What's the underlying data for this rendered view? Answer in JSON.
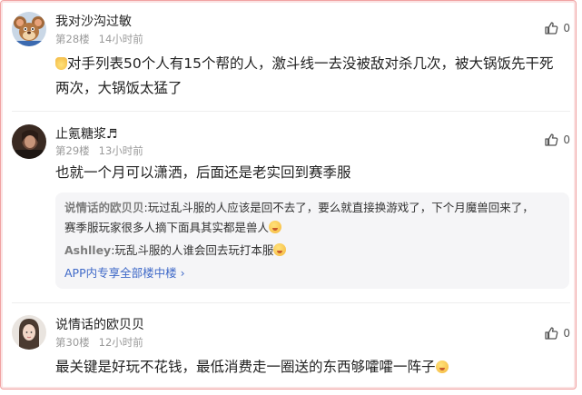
{
  "posts": [
    {
      "username": "我对沙沟过敏",
      "floor": "第28楼",
      "time": "14小时前",
      "likes": "0",
      "content_line1": "对手列表50个人有15个帮的人，激斗线一去没被敌对杀几次，被大锅饭先干死",
      "content_line2": "两次，大锅饭太猛了",
      "avatar_icon": "cartoon-mouse-avatar"
    },
    {
      "username": "止氪糖浆♬",
      "floor": "第29楼",
      "time": "13小时前",
      "likes": "0",
      "content_line1": "也就一个月可以潇洒，后面还是老实回到赛季服",
      "avatar_icon": "dark-photo-avatar",
      "replies": [
        {
          "name": "说情话的欧贝贝",
          "text_line1": ":玩过乱斗服的人应该是回不去了，要么就直接换游戏了，下个月魔兽回来了，",
          "text_line2": "赛季服玩家很多人摘下面具其实都是兽人"
        },
        {
          "name": "Ashlley",
          "text_line1": ":玩乱斗服的人谁会回去玩打本服"
        }
      ],
      "more_link": "APP内专享全部楼中楼 ›"
    },
    {
      "username": "说情话的欧贝贝",
      "floor": "第30楼",
      "time": "12小时前",
      "likes": "0",
      "content_line1": "最关键是好玩不花钱，最低消费走一圈送的东西够嚯嚯一阵子",
      "avatar_icon": "girl-photo-avatar"
    }
  ],
  "colors": {
    "border": "#f0a3a3",
    "link": "#3f69c8",
    "meta": "#9a9a9a",
    "reply_bg": "#f5f5f7"
  }
}
